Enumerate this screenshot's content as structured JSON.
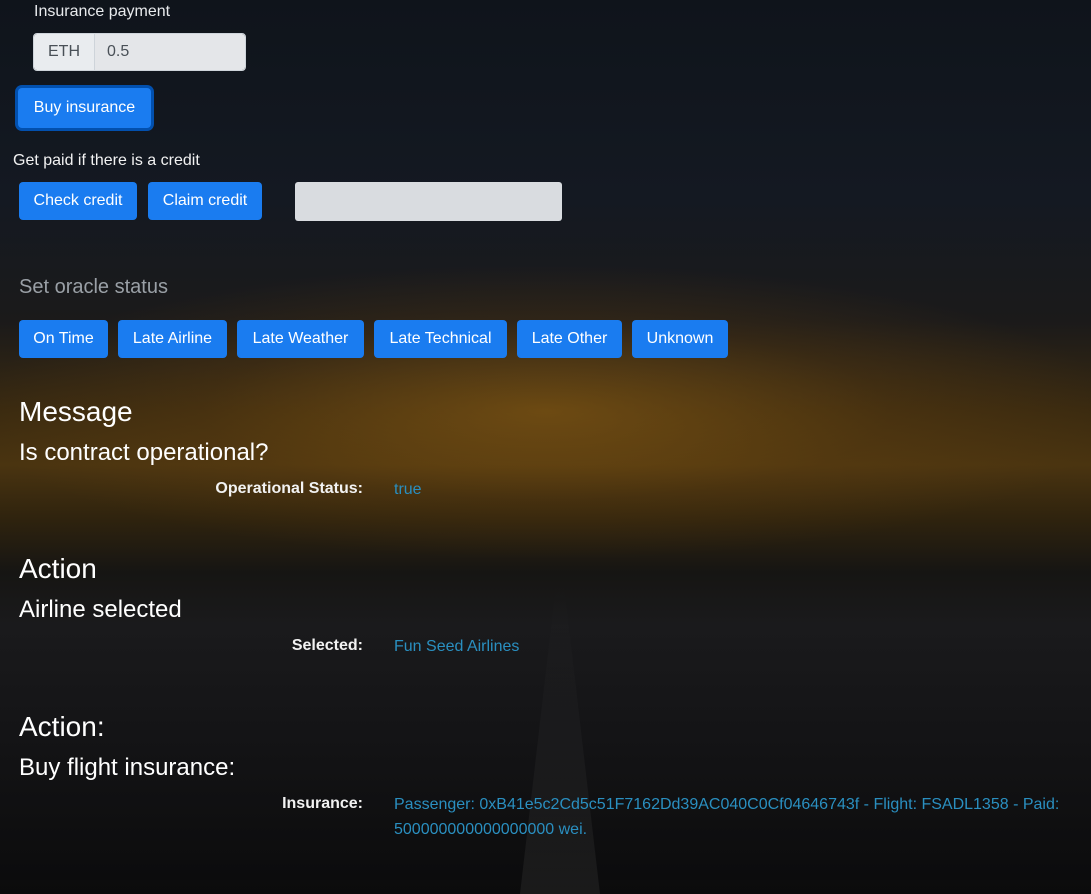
{
  "insurance": {
    "label": "Insurance payment",
    "currency": "ETH",
    "amount": "0.5",
    "buy_label": "Buy insurance"
  },
  "credit": {
    "label": "Get paid if there is a credit",
    "check_label": "Check credit",
    "claim_label": "Claim credit",
    "value": ""
  },
  "oracle": {
    "title": "Set oracle status",
    "buttons": [
      "On Time",
      "Late Airline",
      "Late Weather",
      "Late Technical",
      "Late Other",
      "Unknown"
    ]
  },
  "messages": [
    {
      "heading": "Message",
      "subheading": "Is contract operational?",
      "label": "Operational Status:",
      "value": "true"
    },
    {
      "heading": "Action",
      "subheading": "Airline selected",
      "label": "Selected:",
      "value": "Fun Seed Airlines"
    },
    {
      "heading": "Action:",
      "subheading": "Buy flight insurance:",
      "label": "Insurance:",
      "value_line1": "Passenger: 0xB41e5c2Cd5c51F7162Dd39AC040C0Cf04646743f - Flight: FSADL1358 - Paid:",
      "value_line2": "500000000000000000 wei."
    }
  ],
  "colors": {
    "button": "#1a7cf0",
    "value_text": "#2a8fc0"
  }
}
